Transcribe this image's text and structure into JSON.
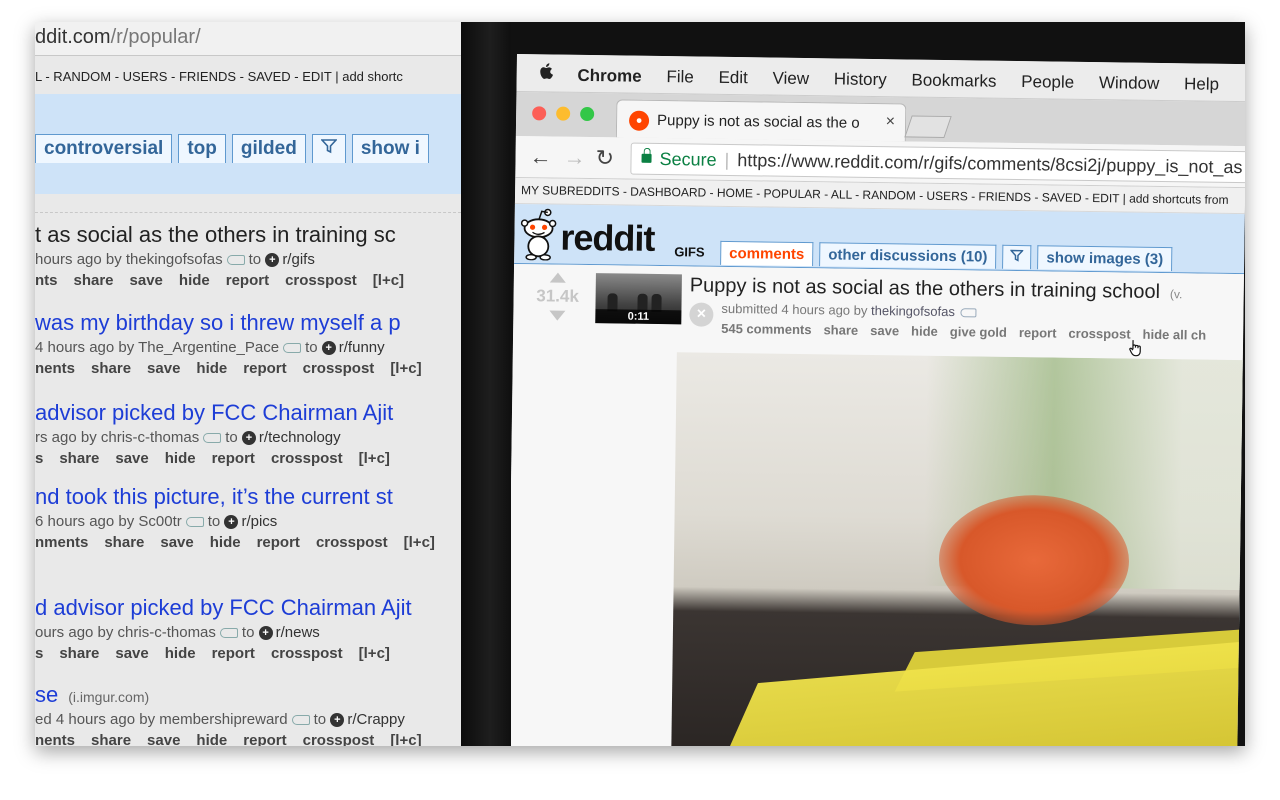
{
  "left_monitor": {
    "url": "ddit.com/r/popular/",
    "url_domain": "ddit.com",
    "url_path": "/r/popular/",
    "nav_text": "L - RANDOM - USERS - FRIENDS - SAVED - EDIT  |   add shortc",
    "tabs": [
      "controversial",
      "top",
      "gilded",
      "show i"
    ],
    "posts": [
      {
        "title": "t as social as the others in training sc",
        "domain": "",
        "meta_prefix": "hours ago by thekingofsofas",
        "subreddit": "r/gifs",
        "actions": [
          "nts",
          "share",
          "save",
          "hide",
          "report",
          "crosspost",
          "[l+c]"
        ]
      },
      {
        "title": "was my birthday so i threw myself a p",
        "domain": "",
        "meta_prefix": "4 hours ago by The_Argentine_Pace",
        "subreddit": "r/funny",
        "actions": [
          "nents",
          "share",
          "save",
          "hide",
          "report",
          "crosspost",
          "[l+c]"
        ]
      },
      {
        "title": "advisor picked by FCC Chairman Ajit",
        "domain": "",
        "meta_prefix": "rs ago by chris-c-thomas",
        "subreddit": "r/technology",
        "actions": [
          "s",
          "share",
          "save",
          "hide",
          "report",
          "crosspost",
          "[l+c]"
        ]
      },
      {
        "title": "nd took this picture, it’s the current st",
        "domain": "",
        "meta_prefix": "6 hours ago by Sc00tr",
        "subreddit": "r/pics",
        "actions": [
          "nments",
          "share",
          "save",
          "hide",
          "report",
          "crosspost",
          "[l+c]"
        ]
      },
      {
        "title": "d advisor picked by FCC Chairman Ajit",
        "domain": "",
        "meta_prefix": "ours ago by chris-c-thomas",
        "subreddit": "r/news",
        "actions": [
          "s",
          "share",
          "save",
          "hide",
          "report",
          "crosspost",
          "[l+c]"
        ]
      },
      {
        "title": "se",
        "domain": "(i.imgur.com)",
        "meta_prefix": "ed 4 hours ago by membershipreward",
        "subreddit": "r/Crappy",
        "actions": [
          "nents",
          "share",
          "save",
          "hide",
          "report",
          "crosspost",
          "[l+c]"
        ]
      }
    ],
    "to_word": "to"
  },
  "mac_menu": {
    "apple_icon": "apple-logo",
    "items": [
      "Chrome",
      "File",
      "Edit",
      "View",
      "History",
      "Bookmarks",
      "People",
      "Window",
      "Help"
    ]
  },
  "browser": {
    "tab_title": "Puppy is not as social as the o",
    "tab_close": "×",
    "secure_label": "Secure",
    "url": "https://www.reddit.com/r/gifs/comments/8csi2j/puppy_is_not_as",
    "traffic_lights": [
      "#fc5f57",
      "#fdbc2e",
      "#33c748"
    ]
  },
  "reddit": {
    "subreddit_bar": "MY SUBREDDITS - DASHBOARD - HOME - POPULAR - ALL - RANDOM - USERS - FRIENDS - SAVED - EDIT  |   add shortcuts from",
    "wordmark": "reddit",
    "sr_name": "GIFS",
    "tabs": {
      "comments": "comments",
      "other": "other discussions (10)",
      "show_images": "show images (3)"
    },
    "post": {
      "score": "31.4k",
      "duration": "0:11",
      "title": "Puppy is not as social as the others in training school",
      "domain": "(v.",
      "submitted": "submitted 4 hours ago by",
      "author": "thekingofsofas",
      "actions": [
        "545 comments",
        "share",
        "save",
        "hide",
        "give gold",
        "report",
        "crosspost",
        "hide all ch"
      ]
    },
    "colors": {
      "header_bg": "#cee3f8",
      "selected_tab": "#ff4500",
      "link": "#336699"
    }
  }
}
